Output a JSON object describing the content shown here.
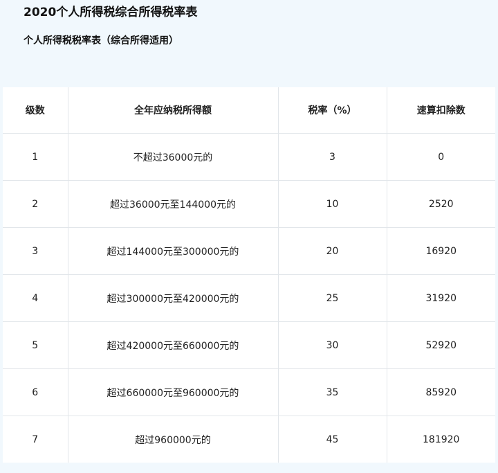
{
  "page": {
    "title": "2020个人所得税综合所得税率表",
    "section_title": "个人所得税税率表（综合所得适用）"
  },
  "table": {
    "headers": [
      "级数",
      "全年应纳税所得额",
      "税率（%）",
      "速算扣除数"
    ],
    "rows": [
      [
        "1",
        "不超过36000元的",
        "3",
        "0"
      ],
      [
        "2",
        "超过36000元至144000元的",
        "10",
        "2520"
      ],
      [
        "3",
        "超过144000元至300000元的",
        "20",
        "16920"
      ],
      [
        "4",
        "超过300000元至420000元的",
        "25",
        "31920"
      ],
      [
        "5",
        "超过420000元至660000元的",
        "30",
        "52920"
      ],
      [
        "6",
        "超过660000元至960000元的",
        "35",
        "85920"
      ],
      [
        "7",
        "超过960000元的",
        "45",
        "181920"
      ]
    ]
  },
  "colors": {
    "background": "#f1f8fd",
    "table_background": "#ffffff",
    "border": "#e2e6ea"
  }
}
